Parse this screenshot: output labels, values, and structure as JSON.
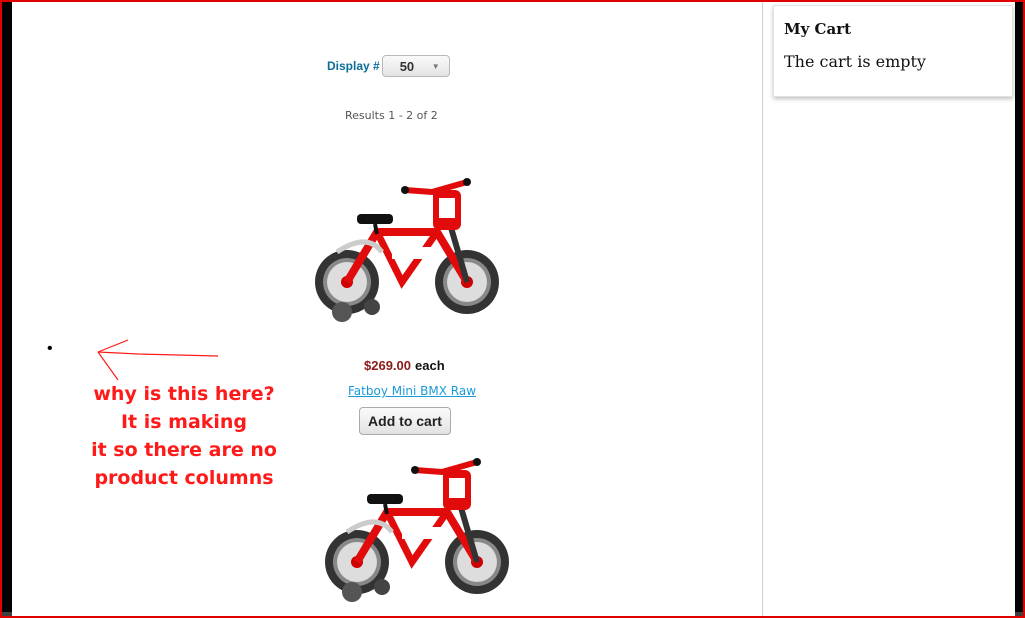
{
  "toolbar": {
    "display_label": "Display #",
    "display_value": "50"
  },
  "results_text": "Results 1 - 2 of 2",
  "products": [
    {
      "price": "$269.00",
      "price_suffix": "each",
      "name": "Fatboy Mini BMX Raw",
      "add_to_cart": "Add to cart",
      "image_icon": "red-kids-bike-image"
    },
    {
      "image_icon": "red-kids-bike-image"
    }
  ],
  "annotation": {
    "bullet": "•",
    "line1": "why is this here?",
    "line2": "It is making",
    "line3": "it so there are no",
    "line4": "product columns",
    "color": "#ff1a1a"
  },
  "cart": {
    "title": "My Cart",
    "empty_text": "The cart is empty"
  },
  "colors": {
    "link": "#1a9bd7",
    "price": "#8b1a1a",
    "label": "#0b6e99",
    "frame_border": "#e00000"
  }
}
